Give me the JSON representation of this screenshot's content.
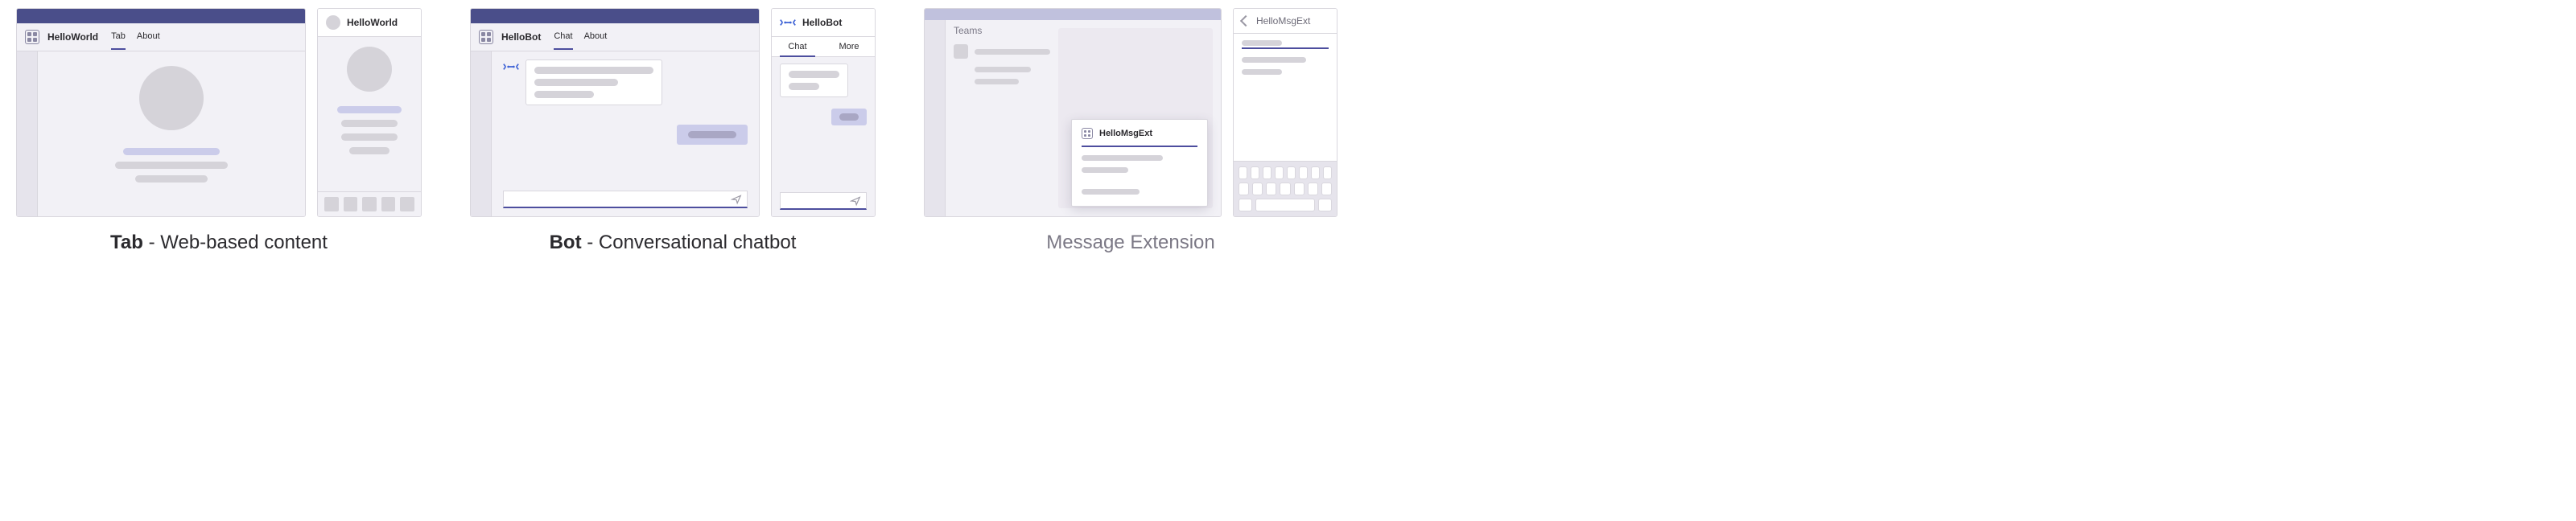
{
  "groups": {
    "tab": {
      "caption_bold": "Tab",
      "caption_rest": " - Web-based content",
      "desktop": {
        "title": "HelloWorld",
        "tabs": [
          "Tab",
          "About"
        ],
        "active_tab": "Tab"
      },
      "mobile": {
        "title": "HelloWorld"
      }
    },
    "bot": {
      "caption_bold": "Bot",
      "caption_rest": " - Conversational chatbot",
      "desktop": {
        "title": "HelloBot",
        "tabs": [
          "Chat",
          "About"
        ],
        "active_tab": "Chat"
      },
      "mobile": {
        "title": "HelloBot",
        "tabs": [
          "Chat",
          "More"
        ],
        "active_tab": "Chat"
      }
    },
    "msgext": {
      "caption": "Message Extension",
      "desktop": {
        "sidebar_title": "Teams",
        "popup_title": "HelloMsgExt"
      },
      "mobile": {
        "title": "HelloMsgExt"
      }
    }
  }
}
